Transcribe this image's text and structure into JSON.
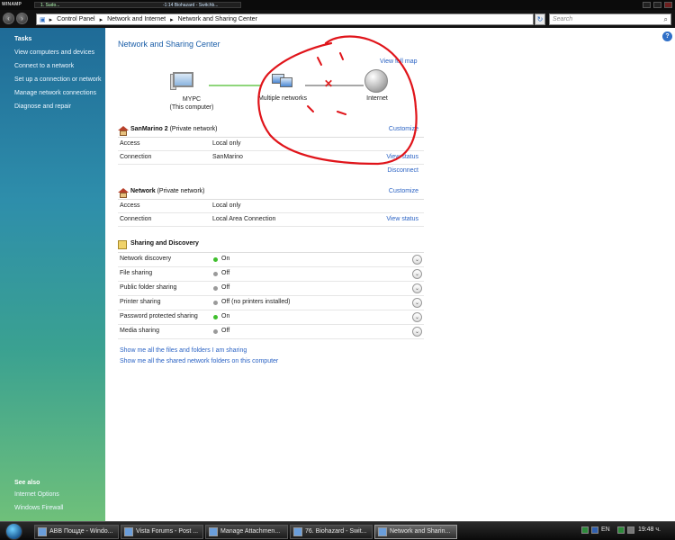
{
  "winamp": {
    "logo": "WINAMP",
    "title": "1. Sudo...",
    "track": "-1:14  Biohazard - Switchb..."
  },
  "address": {
    "crumbs": [
      "Control Panel",
      "Network and Internet",
      "Network and Sharing Center"
    ],
    "search_placeholder": "Search"
  },
  "sidebar": {
    "tasks_heading": "Tasks",
    "items": [
      {
        "label": "View computers and devices"
      },
      {
        "label": "Connect to a network"
      },
      {
        "label": "Set up a connection or network"
      },
      {
        "label": "Manage network connections"
      },
      {
        "label": "Diagnose and repair"
      }
    ],
    "see_also_heading": "See also",
    "see_also": [
      {
        "label": "Internet Options"
      },
      {
        "label": "Windows Firewall"
      }
    ]
  },
  "main": {
    "title": "Network and Sharing Center",
    "view_full_map": "View full map",
    "map": {
      "pc_name": "MYPC",
      "pc_sub": "(This computer)",
      "multi": "Multiple networks",
      "internet": "Internet"
    },
    "networks": [
      {
        "name": "SanMarino  2",
        "type": "(Private network)",
        "customize": "Customize",
        "rows": [
          {
            "label": "Access",
            "value": "Local only",
            "link": ""
          },
          {
            "label": "Connection",
            "value": "SanMarino",
            "link": "View status"
          }
        ],
        "disconnect": "Disconnect"
      },
      {
        "name": "Network",
        "type": "(Private network)",
        "customize": "Customize",
        "rows": [
          {
            "label": "Access",
            "value": "Local only",
            "link": ""
          },
          {
            "label": "Connection",
            "value": "Local Area Connection",
            "link": "View status"
          }
        ]
      }
    ],
    "sharing": {
      "heading": "Sharing and Discovery",
      "rows": [
        {
          "label": "Network discovery",
          "value": "On",
          "state": "on"
        },
        {
          "label": "File sharing",
          "value": "Off",
          "state": "off"
        },
        {
          "label": "Public folder sharing",
          "value": "Off",
          "state": "off"
        },
        {
          "label": "Printer sharing",
          "value": "Off (no printers installed)",
          "state": "off"
        },
        {
          "label": "Password protected sharing",
          "value": "On",
          "state": "on"
        },
        {
          "label": "Media sharing",
          "value": "Off",
          "state": "off"
        }
      ]
    },
    "bottom_links": [
      "Show me all the files and folders I am sharing",
      "Show me all the shared network folders on this computer"
    ]
  },
  "taskbar": {
    "buttons": [
      {
        "label": "АВВ Пощде - Windo..."
      },
      {
        "label": "Vista Forums - Post ..."
      },
      {
        "label": "Manage Attachmen..."
      },
      {
        "label": "76. Biohazard - Swit..."
      },
      {
        "label": "Network and Sharin..."
      }
    ],
    "lang": "EN",
    "clock": "19:48 ч."
  },
  "colors": {
    "link": "#2b63c4",
    "title": "#1b5ea8",
    "annotation": "#e0141a"
  }
}
